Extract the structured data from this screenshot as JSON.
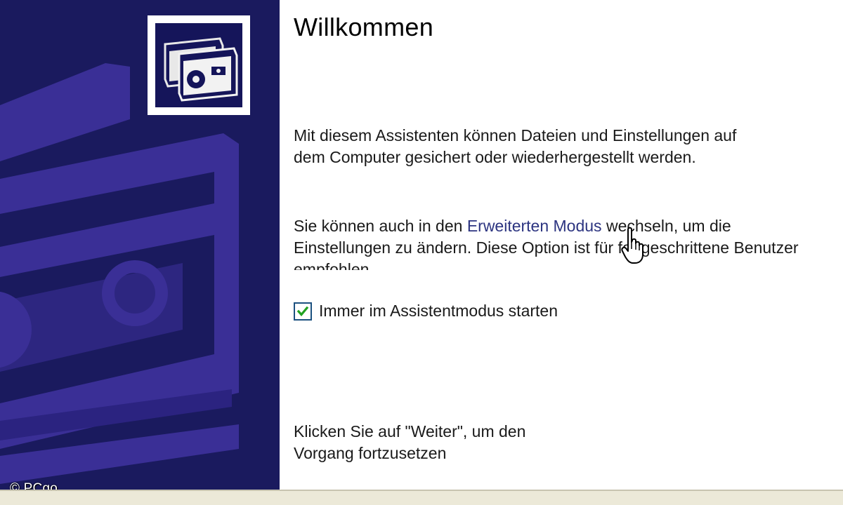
{
  "wizard": {
    "title": "Willkommen",
    "intro_text": "Mit diesem Assistenten können Dateien und Einstellungen auf dem Computer gesichert oder wiederhergestellt werden.",
    "mode_text_before": "Sie können auch in den ",
    "mode_link": "Erweiterten Modus",
    "mode_text_after": " wechseln, um die Einstellungen zu ändern. Diese Option ist für fortgeschrittene Benutzer empfohlen.",
    "checkbox_label": "Immer im Assistentmodus starten",
    "checkbox_checked": true,
    "continue_text": "Klicken Sie auf \"Weiter\", um den Vorgang fortzusetzen"
  },
  "watermark": "© PCgo",
  "icons": {
    "header_icon": "backup-tape-icon",
    "cursor": "hand-pointer-icon",
    "checkmark": "checkmark-icon"
  },
  "colors": {
    "side_panel": "#1a1a5e",
    "art_purple": "#3a2f96",
    "link": "#2c3480",
    "checkbox_border": "#1c5180",
    "checkmark": "#21a121",
    "bottom_strip": "#ece9d8"
  }
}
